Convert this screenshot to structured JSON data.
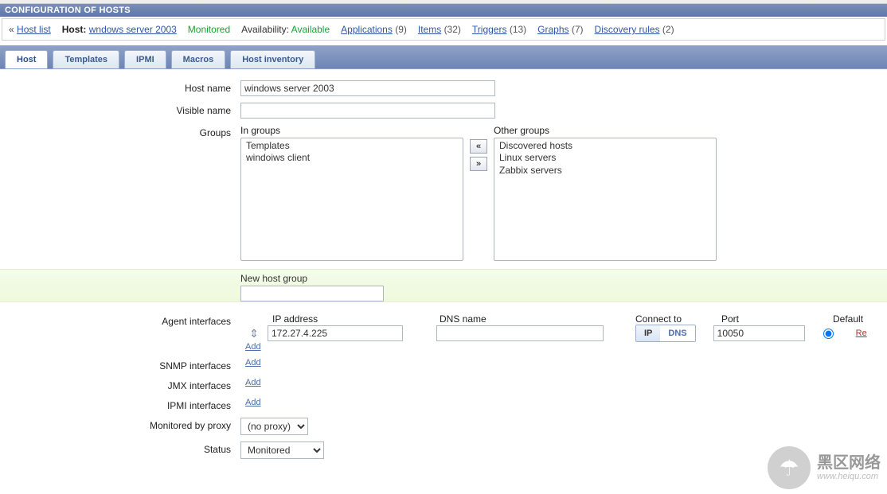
{
  "page_title": "CONFIGURATION OF HOSTS",
  "breadcrumb": {
    "back_symbol": "«",
    "hostlist_link": "Host list",
    "host_label": "Host:",
    "host_name": "wndows server 2003",
    "monitored": "Monitored",
    "availability_label": "Availability:",
    "availability_value": "Available",
    "applications_label": "Applications",
    "applications_count": "(9)",
    "items_label": "Items",
    "items_count": "(32)",
    "triggers_label": "Triggers",
    "triggers_count": "(13)",
    "graphs_label": "Graphs",
    "graphs_count": "(7)",
    "discovery_label": "Discovery rules",
    "discovery_count": "(2)"
  },
  "tabs": {
    "host": "Host",
    "templates": "Templates",
    "ipmi": "IPMI",
    "macros": "Macros",
    "inventory": "Host inventory"
  },
  "form": {
    "hostname_label": "Host name",
    "hostname_value": "windows server 2003",
    "visiblename_label": "Visible name",
    "visiblename_value": "",
    "groups_label": "Groups",
    "in_groups_label": "In groups",
    "other_groups_label": "Other groups",
    "in_groups": [
      "Templates",
      "windoiws client"
    ],
    "other_groups": [
      "Discovered hosts",
      "Linux servers",
      "Zabbix servers"
    ],
    "move_left": "«",
    "move_right": "»",
    "newgroup_label": "New host group",
    "newgroup_value": "",
    "agent_interfaces_label": "Agent interfaces",
    "col_ip": "IP address",
    "col_dns": "DNS name",
    "col_connect": "Connect to",
    "col_port": "Port",
    "col_default": "Default",
    "iface": {
      "ip": "172.27.4.225",
      "dns": "",
      "connect_ip": "IP",
      "connect_dns": "DNS",
      "port": "10050"
    },
    "add_label": "Add",
    "remove_label": "Re",
    "snmp_label": "SNMP interfaces",
    "jmx_label": "JMX interfaces",
    "ipmi_iface_label": "IPMI interfaces",
    "proxy_label": "Monitored by proxy",
    "proxy_value": "(no proxy)",
    "status_label": "Status",
    "status_value": "Monitored"
  },
  "watermark": {
    "big": "黑区网络",
    "small": "www.heiqu.com"
  }
}
